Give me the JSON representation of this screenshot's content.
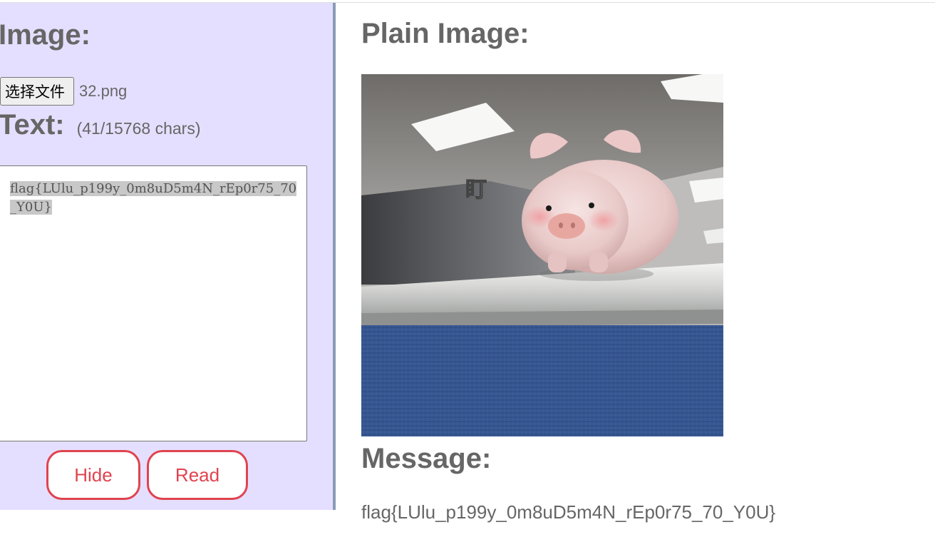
{
  "left": {
    "image_heading": "Image:",
    "file_button_label": "选择文件",
    "file_name": "32.png",
    "text_heading": "Text:",
    "char_count": "(41/15768 chars)",
    "textarea_value": "flag{LUlu_p199y_0m8uD5m4N_rEp0r75_70_Y0U}",
    "hide_button": "Hide",
    "read_button": "Read"
  },
  "right": {
    "plain_image_heading": "Plain Image:",
    "image_caption_char": "盯",
    "message_heading": "Message:",
    "message_text": "flag{LUlu_p199y_0m8uD5m4N_rEp0r75_70_Y0U}"
  },
  "colors": {
    "left_panel_bg": "#e5dfff",
    "divider": "#8a9bb5",
    "button_accent": "#e0434f",
    "heading_text": "#666666"
  }
}
